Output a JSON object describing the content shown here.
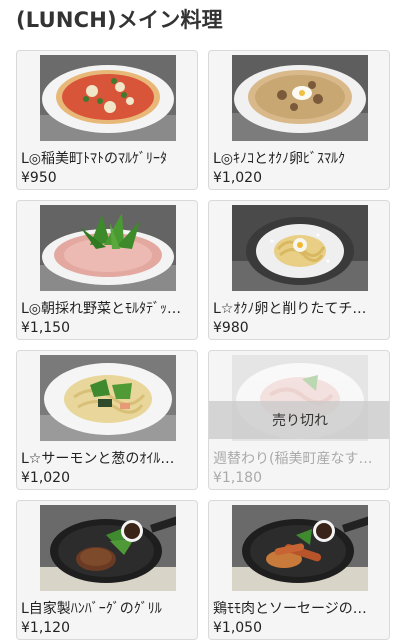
{
  "header": {
    "title": "(LUNCH)メイン料理"
  },
  "items": [
    {
      "name": "L◎稲美町ﾄﾏﾄのﾏﾙｹﾞﾘｰﾀ",
      "price": "¥950",
      "photo_icon": "margherita-pizza-photo"
    },
    {
      "name": "L◎ｷﾉｺとｵｸﾉ卵ﾋﾞｽﾏﾙｸ",
      "price": "¥1,020",
      "photo_icon": "mushroom-egg-pizza-photo"
    },
    {
      "name": "L◎朝採れ野菜とﾓﾙﾀﾃﾞｯ…",
      "price": "¥1,150",
      "photo_icon": "vegetable-mortadella-pizza-photo"
    },
    {
      "name": "L☆ｵｸﾉ卵と削りたてチ…",
      "price": "¥980",
      "photo_icon": "egg-cheese-pasta-photo"
    },
    {
      "name": "L☆サーモンと葱のｵｲﾙ…",
      "price": "¥1,020",
      "photo_icon": "salmon-leek-pasta-photo"
    },
    {
      "name": "週替わり(稲美町産なす…",
      "price": "¥1,180",
      "photo_icon": "weekly-pasta-photo",
      "soldout_label": "売り切れ"
    },
    {
      "name": "L自家製ﾊﾝﾊﾞｰｸﾞのｸﾞﾘﾙ",
      "price": "¥1,120",
      "photo_icon": "hamburg-steak-skillet-photo"
    },
    {
      "name": "鶏ﾓﾓ肉とソーセージの…",
      "price": "¥1,050",
      "photo_icon": "chicken-sausage-skillet-photo"
    }
  ],
  "colors": {
    "card_bg": "#f5f5f5",
    "card_border": "#d9d9d9",
    "soldout_band": "#c8c8c8",
    "text": "#222222",
    "muted_text": "#aaaaaa"
  }
}
